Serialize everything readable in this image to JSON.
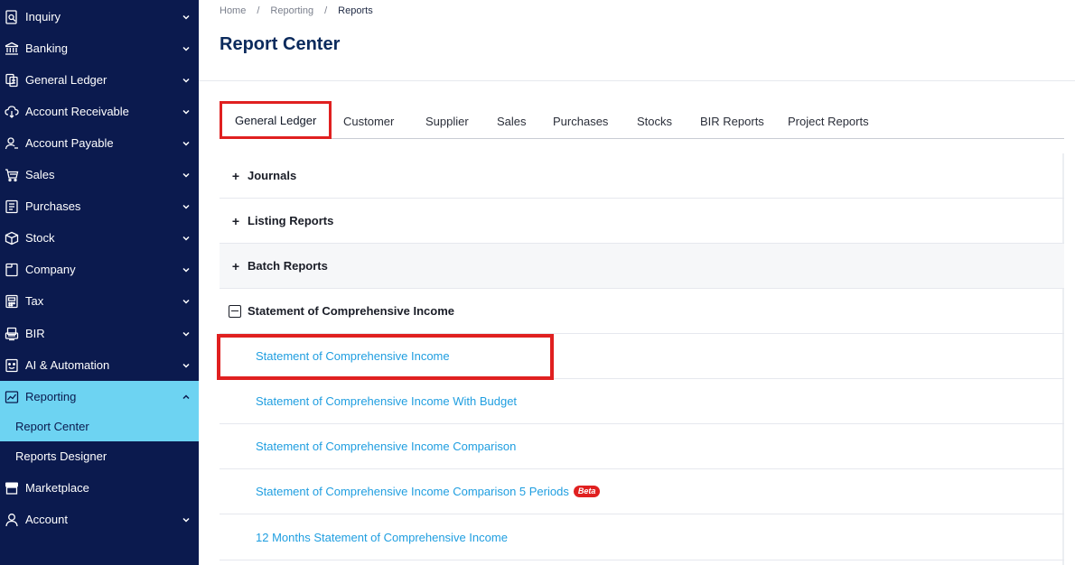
{
  "sidebar": {
    "items": [
      {
        "label": "Inquiry",
        "icon": "inquiry-icon"
      },
      {
        "label": "Banking",
        "icon": "bank-icon"
      },
      {
        "label": "General Ledger",
        "icon": "ledger-icon"
      },
      {
        "label": "Account Receivable",
        "icon": "receivable-icon"
      },
      {
        "label": "Account Payable",
        "icon": "payable-icon"
      },
      {
        "label": "Sales",
        "icon": "cart-icon"
      },
      {
        "label": "Purchases",
        "icon": "purchases-icon"
      },
      {
        "label": "Stock",
        "icon": "box-icon"
      },
      {
        "label": "Company",
        "icon": "company-icon"
      },
      {
        "label": "Tax",
        "icon": "tax-icon"
      },
      {
        "label": "BIR",
        "icon": "bir-icon"
      },
      {
        "label": "AI & Automation",
        "icon": "robot-icon"
      },
      {
        "label": "Reporting",
        "icon": "chart-icon"
      },
      {
        "label": "Marketplace",
        "icon": "store-icon"
      },
      {
        "label": "Account",
        "icon": "user-icon"
      }
    ],
    "sub_items": [
      {
        "label": "Report Center"
      },
      {
        "label": "Reports Designer"
      }
    ],
    "colors": {
      "background": "#0b1a4e",
      "active": "#6dd3f2"
    }
  },
  "breadcrumb": {
    "home": "Home",
    "reporting": "Reporting",
    "reports": "Reports"
  },
  "page": {
    "title": "Report Center"
  },
  "tabs": [
    {
      "label": "General Ledger"
    },
    {
      "label": "Customer"
    },
    {
      "label": "Supplier"
    },
    {
      "label": "Sales"
    },
    {
      "label": "Purchases"
    },
    {
      "label": "Stocks"
    },
    {
      "label": "BIR Reports"
    },
    {
      "label": "Project Reports"
    }
  ],
  "groups": {
    "journals": "Journals",
    "listing": "Listing Reports",
    "batch": "Batch Reports",
    "soci": "Statement of Comprehensive Income"
  },
  "reports": [
    {
      "label": "Statement of Comprehensive Income"
    },
    {
      "label": "Statement of Comprehensive Income With Budget"
    },
    {
      "label": "Statement of Comprehensive Income Comparison"
    },
    {
      "label": "Statement of Comprehensive Income Comparison 5 Periods",
      "badge": "Beta"
    },
    {
      "label": "12 Months Statement of Comprehensive Income"
    }
  ],
  "colors": {
    "link": "#1f9ee0",
    "title": "#0b2a5c",
    "highlight": "#e02020"
  }
}
